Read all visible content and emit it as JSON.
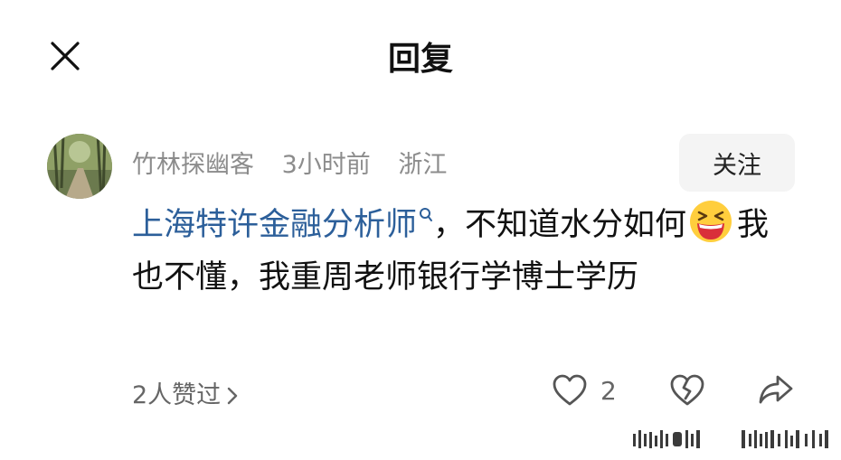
{
  "header": {
    "title": "回复",
    "close_icon": "close-icon"
  },
  "comment": {
    "username": "竹林探幽客",
    "time": "3小时前",
    "location": "浙江",
    "follow_label": "关注",
    "link_text": "上海特许金融分析师",
    "text_part1": "，不知道水分如何",
    "emoji": "grinning-squinting-face",
    "text_part2": "我也不懂，我重周老师银行学博士学历",
    "likes_summary": "2人赞过",
    "like_count": "2"
  },
  "colors": {
    "link": "#2c5f9a",
    "meta": "#8c8c8c",
    "follow_bg": "#f4f4f4"
  }
}
